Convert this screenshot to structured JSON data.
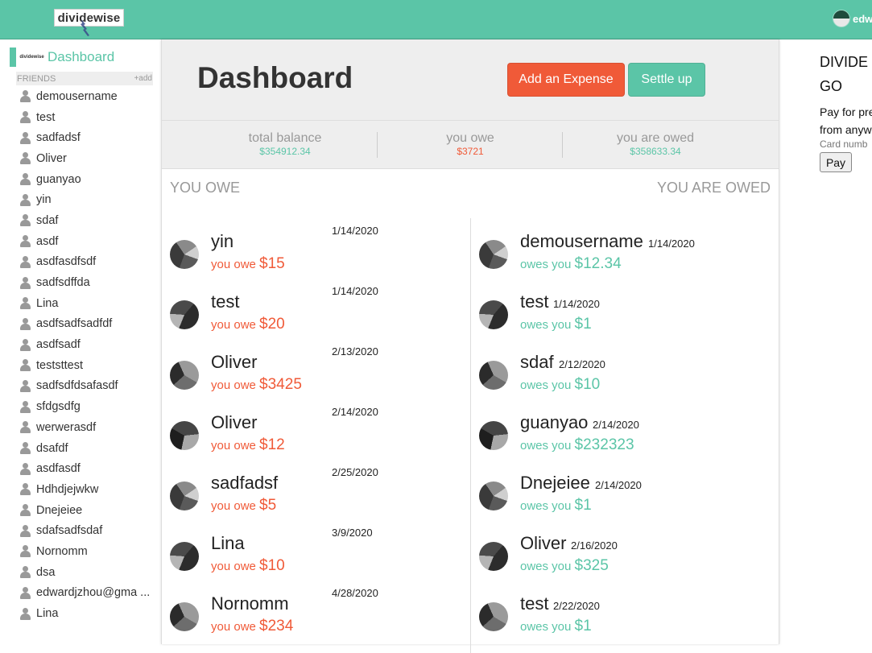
{
  "header": {
    "logo_text": "dividewise",
    "user_name": "edw"
  },
  "sidebar": {
    "dashboard_label": "Dashboard",
    "mini_logo": "dividewise",
    "friends_label": "FRIENDS",
    "add_label": "+add",
    "friends": [
      "demousername",
      "test",
      "sadfadsf",
      "Oliver",
      "guanyao",
      "yin",
      "sdaf",
      "asdf",
      "asdfasdfsdf",
      "sadfsdffda",
      "Lina",
      "asdfsadfsadfdf",
      "asdfsadf",
      "teststtest",
      "sadfsdfdsafasdf",
      "sfdgsdfg",
      "werwerasdf",
      "dsafdf",
      "asdfasdf",
      "Hdhdjejwkw",
      "Dnejeiee",
      "sdafsadfsdaf",
      "Nornomm",
      "dsa",
      "edwardjzhou@gma ...",
      "Lina"
    ]
  },
  "main": {
    "title": "Dashboard",
    "add_expense": "Add an Expense",
    "settle_up": "Settle up",
    "balances": {
      "total_label": "total balance",
      "total_value": "$354912.34",
      "owe_label": "you owe",
      "owe_value": "$3721",
      "owed_label": "you are owed",
      "owed_value": "$358633.34"
    },
    "you_owe_title": "YOU OWE",
    "you_are_owed_title": "YOU ARE OWED",
    "you_owe": [
      {
        "name": "yin",
        "date": "1/14/2020",
        "prefix": "you owe",
        "amount": "$15"
      },
      {
        "name": "test",
        "date": "1/14/2020",
        "prefix": "you owe",
        "amount": "$20"
      },
      {
        "name": "Oliver",
        "date": "2/13/2020",
        "prefix": "you owe",
        "amount": "$3425"
      },
      {
        "name": "Oliver",
        "date": "2/14/2020",
        "prefix": "you owe",
        "amount": "$12"
      },
      {
        "name": "sadfadsf",
        "date": "2/25/2020",
        "prefix": "you owe",
        "amount": "$5"
      },
      {
        "name": "Lina",
        "date": "3/9/2020",
        "prefix": "you owe",
        "amount": "$10"
      },
      {
        "name": "Nornomm",
        "date": "4/28/2020",
        "prefix": "you owe",
        "amount": "$234"
      }
    ],
    "you_are_owed": [
      {
        "name": "demousername",
        "date": "1/14/2020",
        "prefix": "owes you",
        "amount": "$12.34"
      },
      {
        "name": "test",
        "date": "1/14/2020",
        "prefix": "owes you",
        "amount": "$1"
      },
      {
        "name": "sdaf",
        "date": "2/12/2020",
        "prefix": "owes you",
        "amount": "$10"
      },
      {
        "name": "guanyao",
        "date": "2/14/2020",
        "prefix": "owes you",
        "amount": "$232323"
      },
      {
        "name": "Dnejeiee",
        "date": "2/14/2020",
        "prefix": "owes you",
        "amount": "$1"
      },
      {
        "name": "Oliver",
        "date": "2/16/2020",
        "prefix": "owes you",
        "amount": "$325"
      },
      {
        "name": "test",
        "date": "2/22/2020",
        "prefix": "owes you",
        "amount": "$1"
      }
    ]
  },
  "right_panel": {
    "title_line1": "DIVIDE",
    "title_line2": "GO",
    "text_line1": "Pay for pre",
    "text_line2": "from anyw",
    "card_label": "Card numb",
    "pay_button": "Pay"
  },
  "colors": {
    "brand_green": "#5bc5a7",
    "owe_orange": "#f05a38"
  }
}
